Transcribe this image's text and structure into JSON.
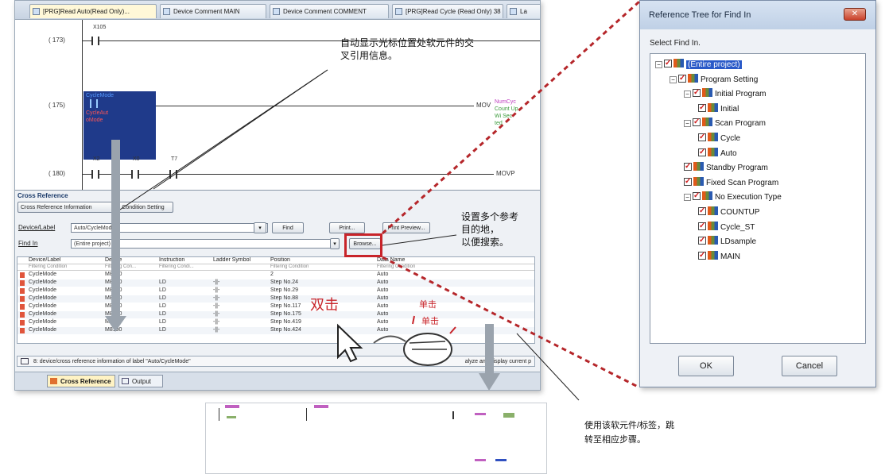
{
  "tabs": [
    {
      "label": "[PRG]Read Auto(Read Only)...",
      "active": true
    },
    {
      "label": "Device Comment MAIN",
      "active": false
    },
    {
      "label": "Device Comment COMMENT",
      "active": false
    },
    {
      "label": "[PRG]Read Cycle (Read Only) 38 ...",
      "active": false
    },
    {
      "label": "La",
      "active": false
    }
  ],
  "ladder": {
    "steps": [
      "( 173)",
      "( 175)",
      "( 180)"
    ],
    "rung1_device": "X105",
    "rung2_devices": [
      "CycleMode",
      "CycleAut",
      "oMode"
    ],
    "rung2_instr": "MOV",
    "rung2_comments": [
      "NumCyc",
      "Count Up",
      "Wi Sec",
      "ted"
    ],
    "rung3_devices": [
      "X2",
      "X0",
      "T7"
    ],
    "rung3_instr": "MOVP"
  },
  "xref": {
    "panel_title": "Cross Reference",
    "tab1": "Cross Reference Information",
    "tab2": "Condition Setting",
    "device_label": "Device/Label",
    "device_value": "Auto/CycleMode",
    "find_in_label": "Find In",
    "find_in_value": "(Entire project)",
    "find_button": "Find",
    "print_button": "Print...",
    "print_preview_button": "Print Preview...",
    "browse_button": "Browse...",
    "columns": [
      "Device/Label",
      "Device",
      "Instruction",
      "Ladder Symbol",
      "Position",
      "Data Name"
    ],
    "filters": [
      "Filtering Condition",
      "Filtering Con...",
      "Filtering Condi...",
      "",
      "Filtering Condition",
      "Filtering Condition"
    ],
    "rows": [
      [
        "CycleMode",
        "M8190",
        "",
        "",
        "2",
        "Auto"
      ],
      [
        "CycleMode",
        "M8190",
        "LD",
        "-||-",
        "Step No.24",
        "Auto"
      ],
      [
        "CycleMode",
        "M8190",
        "LD",
        "-||-",
        "Step No.29",
        "Auto"
      ],
      [
        "CycleMode",
        "M8190",
        "LD",
        "-||-",
        "Step No.88",
        "Auto"
      ],
      [
        "CycleMode",
        "M8190",
        "LD",
        "-||-",
        "Step No.117",
        "Auto"
      ],
      [
        "CycleMode",
        "M8190",
        "LD",
        "-||-",
        "Step No.175",
        "Auto"
      ],
      [
        "CycleMode",
        "M8190",
        "LD",
        "-||-",
        "Step No.419",
        "Auto"
      ],
      [
        "CycleMode",
        "M8190",
        "LD",
        "-||-",
        "Step No.424",
        "Auto"
      ]
    ],
    "status_text": "8: device/cross reference information of label \"Auto/CycleMode\"",
    "status_right": "alyze and display current p",
    "bottom_tab1": "Cross Reference",
    "bottom_tab2": "Output"
  },
  "dialog": {
    "title": "Reference Tree for Find In",
    "close": "✕",
    "select_label": "Select Find In.",
    "tree": [
      {
        "label": "(Entire project)",
        "level": 0,
        "selected": true,
        "expander": "⊟"
      },
      {
        "label": "Program Setting",
        "level": 1,
        "expander": "⊟"
      },
      {
        "label": "Initial Program",
        "level": 2,
        "expander": "⊟"
      },
      {
        "label": "Initial",
        "level": 3
      },
      {
        "label": "Scan Program",
        "level": 2,
        "expander": "⊟"
      },
      {
        "label": "Cycle",
        "level": 3
      },
      {
        "label": "Auto",
        "level": 3
      },
      {
        "label": "Standby Program",
        "level": 2
      },
      {
        "label": "Fixed Scan Program",
        "level": 2
      },
      {
        "label": "No Execution Type",
        "level": 2,
        "expander": "⊟"
      },
      {
        "label": "COUNTUP",
        "level": 3
      },
      {
        "label": "Cycle_ST",
        "level": 3
      },
      {
        "label": "LDsample",
        "level": 3
      },
      {
        "label": "MAIN",
        "level": 3
      }
    ],
    "ok_button": "OK",
    "cancel_button": "Cancel"
  },
  "annotations": {
    "note1_line1": "自动显示光标位置处软元件的交",
    "note1_line2": "叉引用信息。",
    "note2_line1": "设置多个参考",
    "note2_line2": "目的地，",
    "note2_line3": "以便搜索。",
    "double_click": "双击",
    "single_click1": "单击",
    "single_click2": "单击",
    "note3_line1": "使用该软元件/标签，跳",
    "note3_line2": "转至相应步骤。"
  },
  "colors": {
    "accent_red": "#c8242a",
    "arrow_gray": "#9aa3ad",
    "selection_blue": "#1f3a8a"
  }
}
